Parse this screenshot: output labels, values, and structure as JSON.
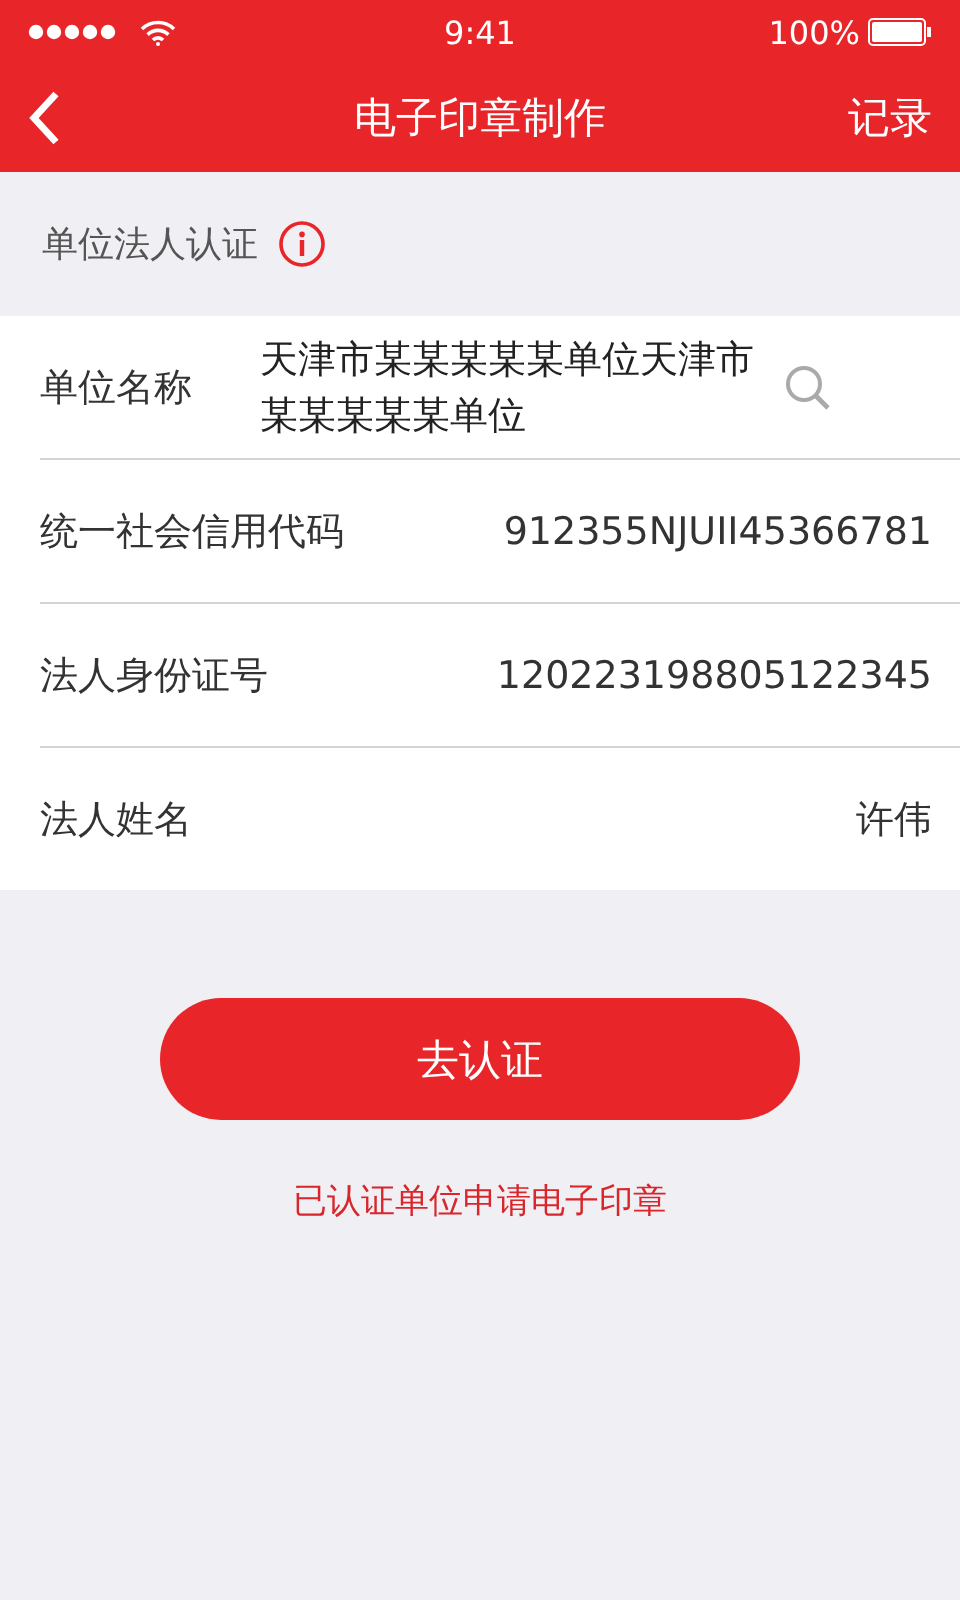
{
  "status_bar": {
    "time": "9:41",
    "battery": "100%"
  },
  "nav": {
    "title": "电子印章制作",
    "action": "记录"
  },
  "section": {
    "title": "单位法人认证"
  },
  "rows": [
    {
      "kind": "search",
      "label": "单位名称",
      "value": "天津市某某某某某单位天津市某某某某某单位"
    },
    {
      "kind": "text",
      "label": "统一社会信用代码",
      "value": "912355NJUII45366781"
    },
    {
      "kind": "text",
      "label": "法人身份证号",
      "value": "120223198805122345"
    },
    {
      "kind": "text",
      "label": "法人姓名",
      "value": "许伟"
    }
  ],
  "submit": {
    "label": "去认证"
  },
  "link": {
    "label": "已认证单位申请电子印章"
  }
}
